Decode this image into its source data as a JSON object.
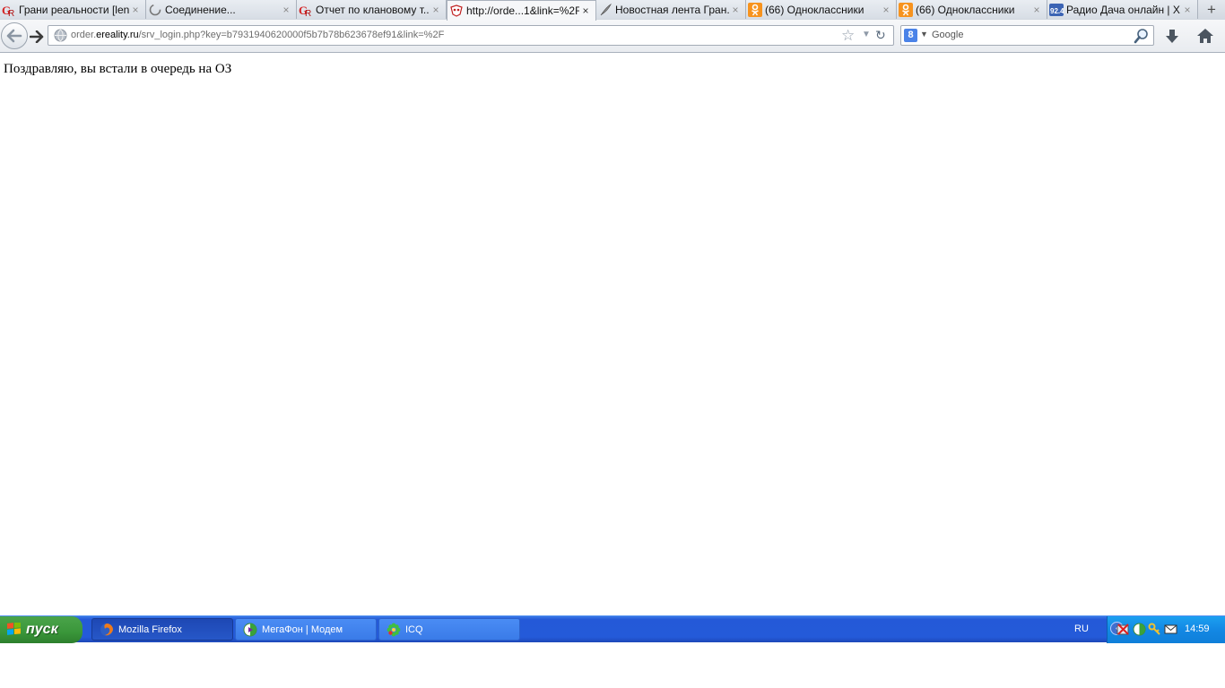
{
  "tabs": [
    {
      "title": "Грани реальности [len...",
      "icon": "ereality-icon",
      "active": false
    },
    {
      "title": "Соединение...",
      "icon": "loading-icon",
      "active": false
    },
    {
      "title": "Отчет по клановому т...",
      "icon": "ereality-icon",
      "active": false
    },
    {
      "title": "http://orde...1&link=%2F",
      "icon": "ereality-mask-icon",
      "active": true
    },
    {
      "title": "Новостная лента Гран...",
      "icon": "feather-icon",
      "active": false
    },
    {
      "title": "(66) Одноклассники",
      "icon": "odnoklassniki-icon",
      "active": false
    },
    {
      "title": "(66) Одноклассники",
      "icon": "odnoklassniki-icon",
      "active": false
    },
    {
      "title": "Радио Дача онлайн | Х...",
      "icon": "radio-icon",
      "active": false
    }
  ],
  "newtab_label": "+",
  "close_glyph": "×",
  "urlbar": {
    "host": "order.ereality.ru",
    "host_prefix": "order.",
    "host_main": "ereality.ru",
    "path": "/srv_login.php?key=b7931940620000f5b7b78b623678ef91&link=%2F"
  },
  "search": {
    "engine": "Google",
    "placeholder": "Google",
    "engine_letter": "8"
  },
  "page": {
    "message": "Поздравляю, вы встали в очередь на ОЗ"
  },
  "taskbar": {
    "start_label": "пуск",
    "tasks": [
      {
        "label": "Mozilla Firefox",
        "icon": "firefox-icon",
        "active": true
      },
      {
        "label": "МегаФон | Модем",
        "icon": "megafon-icon",
        "active": false
      },
      {
        "label": "ICQ",
        "icon": "icq-flower-icon",
        "active": false
      }
    ],
    "language": "RU",
    "clock": "14:59"
  },
  "colors": {
    "taskbar_blue": "#245ad9",
    "start_green": "#3a963a",
    "tray_blue": "#1388e4"
  }
}
